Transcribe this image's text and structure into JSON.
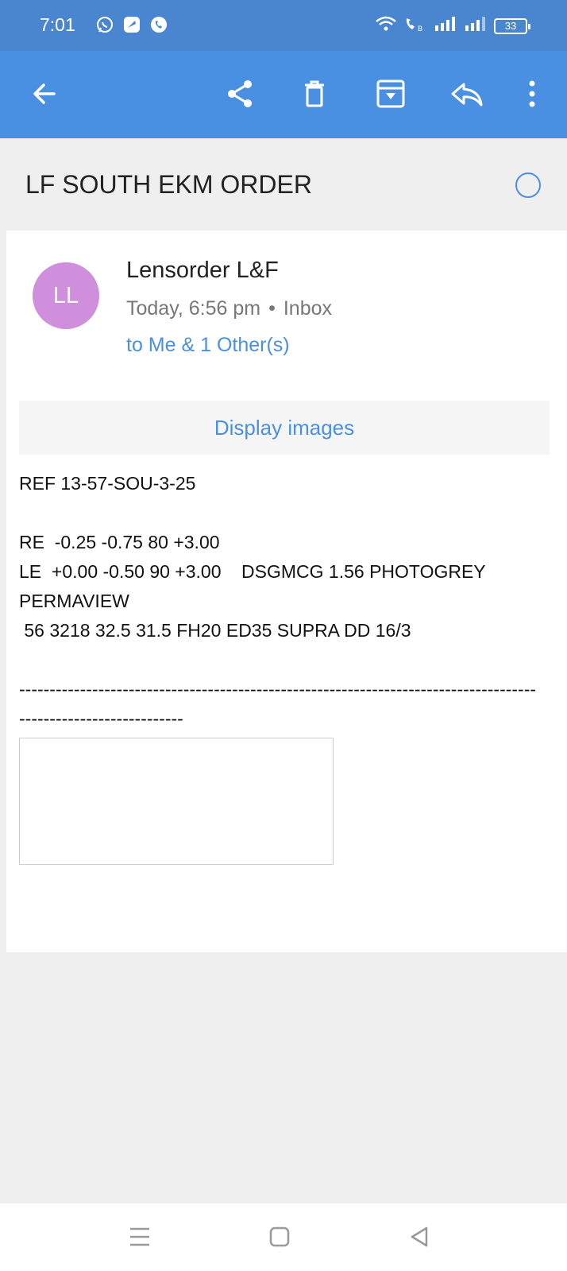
{
  "status_bar": {
    "time": "7:01",
    "battery": "33",
    "left_icons": [
      "whatsapp-icon",
      "messenger-icon",
      "phone-status-icon"
    ],
    "right_icons": [
      "wifi-icon",
      "volte-icon",
      "signal-icon",
      "signal-icon-2"
    ]
  },
  "toolbar": {
    "icons": [
      "back-arrow-icon",
      "share-icon",
      "delete-icon",
      "archive-icon",
      "reply-icon",
      "more-options-icon"
    ]
  },
  "email": {
    "subject": "LF SOUTH EKM ORDER",
    "avatar_initials": "LL",
    "avatar_color": "#cf8fdd",
    "sender": "Lensorder L&F",
    "date": "Today, 6:56 pm",
    "separator": "•",
    "folder": "Inbox",
    "recipients": "to Me & 1 Other(s)",
    "display_images_label": "Display images",
    "body_lines": [
      "REF 13-57-SOU-3-25",
      "",
      "RE  -0.25 -0.75 80 +3.00",
      "LE  +0.00 -0.50 90 +3.00    DSGMCG 1.56 PHOTOGREY",
      "PERMAVIEW",
      " 56 3218 32.5 31.5 FH20 ED35 SUPRA DD 16/3",
      ""
    ],
    "dashes_line1": "-------------------------------------------------------------------------------------",
    "dashes_line2": "---------------------------"
  },
  "nav_bar": {
    "icons": [
      "recents-menu-icon",
      "home-icon",
      "back-triangle-icon"
    ]
  },
  "colors": {
    "status_bar": "#4a86cf",
    "toolbar": "#4a90e2",
    "accent": "#4a90e2",
    "background": "#efefef"
  }
}
